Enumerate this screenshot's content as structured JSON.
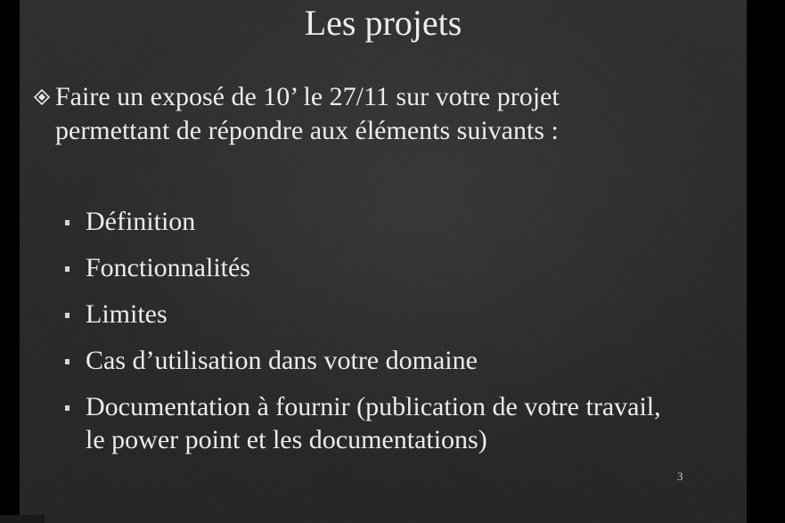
{
  "slide": {
    "title": "Les projets",
    "main_point": {
      "bullet_icon": "diamond-bullet-icon",
      "line1": "Faire un exposé de 10’ le 27/11 sur votre projet",
      "line2": "permettant de répondre aux éléments suivants :"
    },
    "sub_items": [
      {
        "label": "Définition"
      },
      {
        "label": "Fonctionnalités"
      },
      {
        "label": "Limites"
      },
      {
        "label": "Cas d’utilisation dans votre domaine"
      },
      {
        "label": "Documentation à fournir (publication de votre travail,",
        "label2": "le power point et les documentations)"
      }
    ],
    "page_number": "3"
  },
  "colors": {
    "background": "#2c2c2c",
    "text": "#ececec",
    "letterbox": "#000000"
  }
}
